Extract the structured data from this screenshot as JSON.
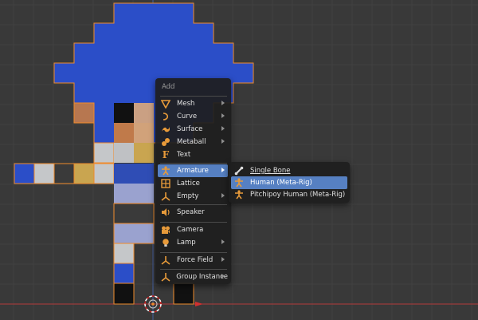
{
  "colors": {
    "background": "#393939",
    "grid_line": "#414141",
    "grid_major": "#4a4a4a",
    "x_axis": "#b23a3a",
    "y_axis": "#4461a0",
    "selection_outline": "#f08a2a",
    "menu_bg": "#1e1e1e",
    "menu_highlight": "#5680c2",
    "icon_orange": "#e79a3a"
  },
  "add_menu": {
    "title": "Add",
    "items": [
      {
        "label": "Mesh",
        "icon": "mesh-icon",
        "submenu": true
      },
      {
        "label": "Curve",
        "icon": "curve-icon",
        "submenu": true
      },
      {
        "label": "Surface",
        "icon": "surface-icon",
        "submenu": true
      },
      {
        "label": "Metaball",
        "icon": "metaball-icon",
        "submenu": true
      },
      {
        "label": "Text",
        "icon": "text-icon",
        "submenu": false
      },
      {
        "label": "Armature",
        "icon": "armature-icon",
        "submenu": true,
        "highlighted": true
      },
      {
        "label": "Lattice",
        "icon": "lattice-icon",
        "submenu": false
      },
      {
        "label": "Empty",
        "icon": "empty-icon",
        "submenu": true
      },
      {
        "label": "Speaker",
        "icon": "speaker-icon",
        "submenu": false
      },
      {
        "label": "Camera",
        "icon": "camera-icon",
        "submenu": false
      },
      {
        "label": "Lamp",
        "icon": "lamp-icon",
        "submenu": true
      },
      {
        "label": "Force Field",
        "icon": "force-field-icon",
        "submenu": true
      },
      {
        "label": "Group Instance",
        "icon": "group-instance-icon",
        "submenu": true
      }
    ]
  },
  "armature_submenu": {
    "items": [
      {
        "label": "Single Bone",
        "icon": "bone-icon"
      },
      {
        "label": "Human (Meta-Rig)",
        "icon": "human-rig-icon",
        "highlighted": true
      },
      {
        "label": "Pitchipoy Human (Meta-Rig)",
        "icon": "human-rig-icon"
      }
    ]
  },
  "pixel_character": {
    "head_color": "#2b4ec8",
    "skin_color": "#c88e5e",
    "dark_color": "#111111",
    "light_color": "#c5c7c9",
    "shirt_color": "#3050b8",
    "pants_color": "#9aa2cf"
  }
}
